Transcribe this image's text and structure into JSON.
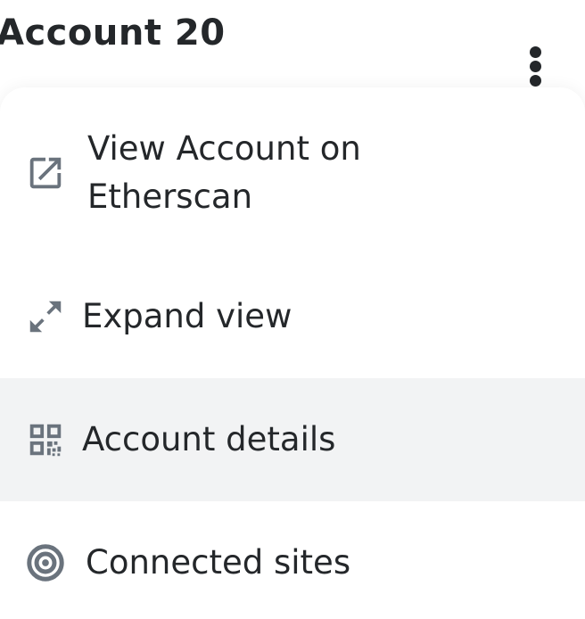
{
  "header": {
    "account_name": "Account 20",
    "menu_button_icon": "kebab-vertical-icon"
  },
  "menu": {
    "items": [
      {
        "label_line1": "View Account on",
        "label_line2": "Etherscan",
        "icon": "external-link-icon"
      },
      {
        "label": "Expand view",
        "icon": "expand-arrows-icon"
      },
      {
        "label": "Account details",
        "icon": "qr-code-icon",
        "highlighted": true
      },
      {
        "label": "Connected sites",
        "icon": "connected-sites-icon"
      }
    ]
  },
  "colors": {
    "text": "#24272a",
    "icon": "#6a737d",
    "highlight_background": "#f2f3f4"
  }
}
